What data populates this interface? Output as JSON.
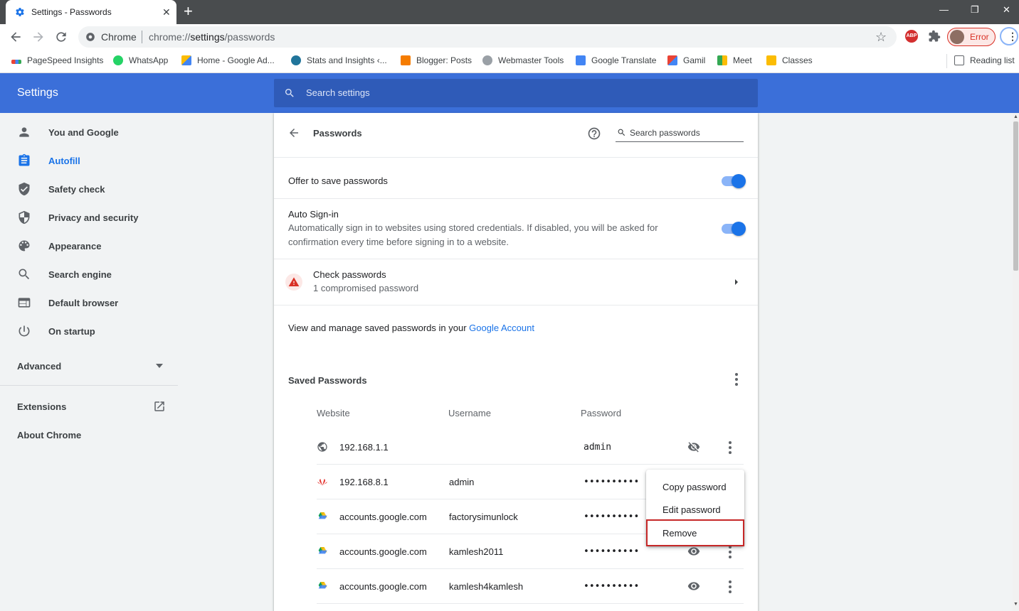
{
  "browser": {
    "tab_title": "Settings - Passwords",
    "omnibox_chip": "Chrome",
    "url_prefix": "chrome://",
    "url_path": "settings",
    "url_suffix": "/passwords",
    "profile_status": "Error"
  },
  "bookmarks": [
    {
      "label": "PageSpeed Insights",
      "icon": "pagespeed-icon"
    },
    {
      "label": "WhatsApp",
      "icon": "whatsapp-icon"
    },
    {
      "label": "Home - Google Ad...",
      "icon": "google-ads-icon"
    },
    {
      "label": "Stats and Insights ‹...",
      "icon": "wordpress-icon"
    },
    {
      "label": "Blogger: Posts",
      "icon": "blogger-icon"
    },
    {
      "label": "Webmaster Tools",
      "icon": "webmaster-icon"
    },
    {
      "label": "Google Translate",
      "icon": "translate-icon"
    },
    {
      "label": "Gamil",
      "icon": "gmail-icon"
    },
    {
      "label": "Meet",
      "icon": "meet-icon"
    },
    {
      "label": "Classes",
      "icon": "classroom-icon"
    }
  ],
  "reading_list": "Reading list",
  "settings": {
    "title": "Settings",
    "search_placeholder": "Search settings"
  },
  "sidebar": {
    "items": [
      {
        "label": "You and Google",
        "icon": "person-icon"
      },
      {
        "label": "Autofill",
        "icon": "clipboard-icon",
        "active": true
      },
      {
        "label": "Safety check",
        "icon": "shield-check-icon"
      },
      {
        "label": "Privacy and security",
        "icon": "shield-half-icon"
      },
      {
        "label": "Appearance",
        "icon": "palette-icon"
      },
      {
        "label": "Search engine",
        "icon": "search-icon"
      },
      {
        "label": "Default browser",
        "icon": "browser-icon"
      },
      {
        "label": "On startup",
        "icon": "power-icon"
      }
    ],
    "advanced": "Advanced",
    "extensions": "Extensions",
    "about": "About Chrome"
  },
  "passwords": {
    "title": "Passwords",
    "search_placeholder": "Search passwords",
    "offer_to_save": "Offer to save passwords",
    "offer_to_save_enabled": true,
    "auto_signin_title": "Auto Sign-in",
    "auto_signin_desc": "Automatically sign in to websites using stored credentials. If disabled, you will be asked for confirmation every time before signing in to a website.",
    "auto_signin_enabled": true,
    "check_title": "Check passwords",
    "check_sub": "1 compromised password",
    "manage_text": "View and manage saved passwords in your ",
    "manage_link": "Google Account",
    "saved_header": "Saved Passwords",
    "columns": {
      "website": "Website",
      "username": "Username",
      "password": "Password"
    },
    "rows": [
      {
        "site": "192.168.1.1",
        "user": "",
        "pass": "admin",
        "icon": "globe-icon",
        "revealed": true
      },
      {
        "site": "192.168.8.1",
        "user": "admin",
        "pass": "••••••••••",
        "icon": "huawei-icon",
        "revealed": false
      },
      {
        "site": "accounts.google.com",
        "user": "factorysimunlock",
        "pass": "••••••••••",
        "icon": "google-drive-icon",
        "revealed": false
      },
      {
        "site": "accounts.google.com",
        "user": "kamlesh2011",
        "pass": "••••••••••",
        "icon": "google-drive-icon",
        "revealed": false
      },
      {
        "site": "accounts.google.com",
        "user": "kamlesh4kamlesh",
        "pass": "••••••••••",
        "icon": "google-drive-icon",
        "revealed": false
      }
    ]
  },
  "context_menu": {
    "copy": "Copy password",
    "edit": "Edit password",
    "remove": "Remove"
  },
  "colors": {
    "header_blue": "#3b6fd9",
    "accent": "#1a73e8",
    "warning_red": "#d93025"
  }
}
